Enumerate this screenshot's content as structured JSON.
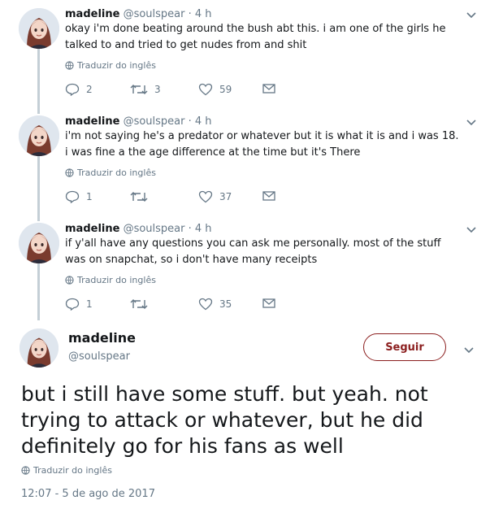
{
  "replies": [
    {
      "name": "madeline",
      "handle": "@soulspear",
      "time": "· 4 h",
      "text": "okay i'm done beating around the bush abt this. i am one of the girls he talked to and tried to get nudes from and shit",
      "translate": "Traduzir do inglês",
      "replies": "2",
      "retweets": "3",
      "likes": "59"
    },
    {
      "name": "madeline",
      "handle": "@soulspear",
      "time": "· 4 h",
      "text": "i'm not saying he's a predator or whatever but it is what it is and i was 18. i was fine a the age difference at the time but it's There",
      "translate": "Traduzir do inglês",
      "replies": "1",
      "retweets": "",
      "likes": "37"
    },
    {
      "name": "madeline",
      "handle": "@soulspear",
      "time": "· 4 h",
      "text": "if y'all have any questions you can ask me personally. most of the stuff was on snapchat, so i don't have many receipts",
      "translate": "Traduzir do inglês",
      "replies": "1",
      "retweets": "",
      "likes": "35"
    }
  ],
  "main": {
    "name": "madeline",
    "handle": "@soulspear",
    "follow_label": "Seguir",
    "text": "but i still have some stuff. but yeah. not trying to attack or whatever, but he did definitely go for his fans as well",
    "translate": "Traduzir do inglês",
    "timestamp": "12:07 - 5 de ago de 2017"
  },
  "colors": {
    "accent": "#8b1e1e",
    "secondary_text": "#657786",
    "thread_line": "#c4cfd6"
  },
  "icons": [
    "avatar",
    "chevron-down-icon",
    "globe-icon",
    "reply-icon",
    "retweet-icon",
    "heart-icon",
    "message-icon"
  ]
}
